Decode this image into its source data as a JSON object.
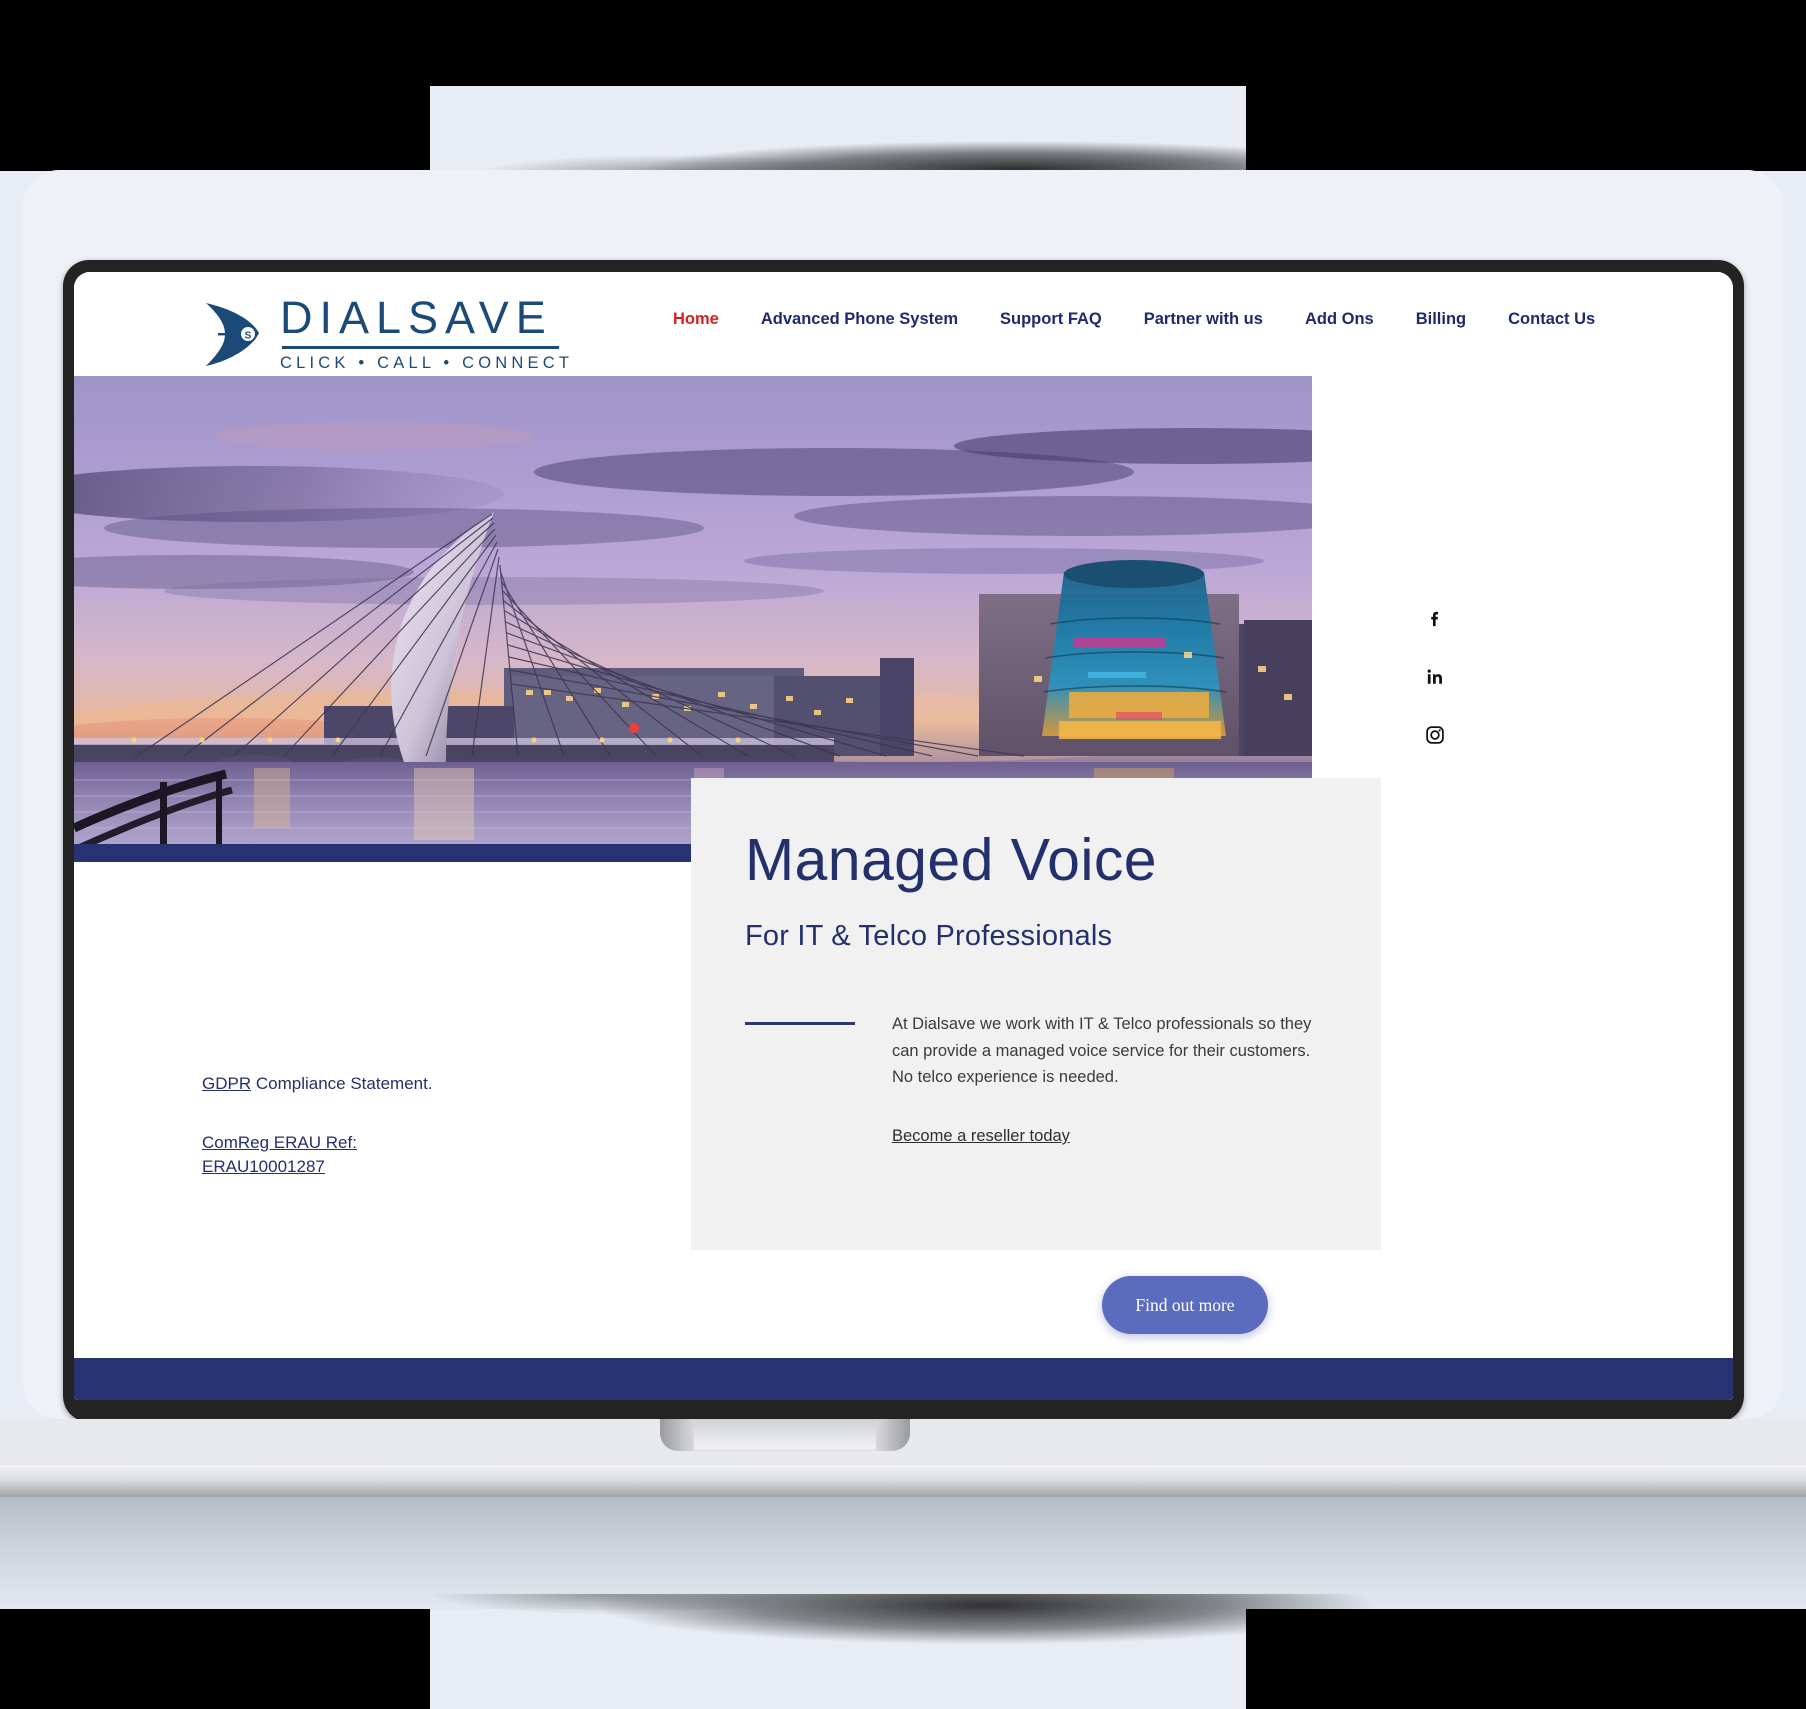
{
  "brand": {
    "logo_main": "DIALSAVE",
    "logo_sub": "CLICK • CALL • CONNECT",
    "logo_mark_letter": "S",
    "navy": "#23306b",
    "accent_red": "#d62020",
    "button_blue": "#5b6cbf",
    "band_navy": "#273272"
  },
  "nav": {
    "items": [
      {
        "label": "Home",
        "active": true
      },
      {
        "label": "Advanced Phone System",
        "active": false
      },
      {
        "label": "Support FAQ",
        "active": false
      },
      {
        "label": "Partner with us",
        "active": false
      },
      {
        "label": "Add Ons",
        "active": false
      },
      {
        "label": "Billing",
        "active": false
      },
      {
        "label": "Contact Us",
        "active": false
      }
    ]
  },
  "hero": {
    "alt": "Samuel Beckett Bridge and Convention Centre Dublin at sunset"
  },
  "card": {
    "title": "Managed Voice",
    "subtitle": "For IT & Telco Professionals",
    "paragraph": "At Dialsave we work with IT & Telco professionals so they can provide a managed voice service for their customers. No telco experience is needed.",
    "link": "Become a reseller today"
  },
  "left_links": {
    "gdpr_link": "GDPR",
    "gdpr_rest": " Compliance Statement.",
    "comreg_line1": "ComReg ERAU Ref:",
    "comreg_line2": "ERAU10001287"
  },
  "cta": {
    "label": "Find out more"
  },
  "social": {
    "items": [
      {
        "name": "facebook",
        "glyph": "f"
      },
      {
        "name": "linkedin",
        "glyph": "in"
      },
      {
        "name": "instagram",
        "glyph": ""
      }
    ]
  }
}
